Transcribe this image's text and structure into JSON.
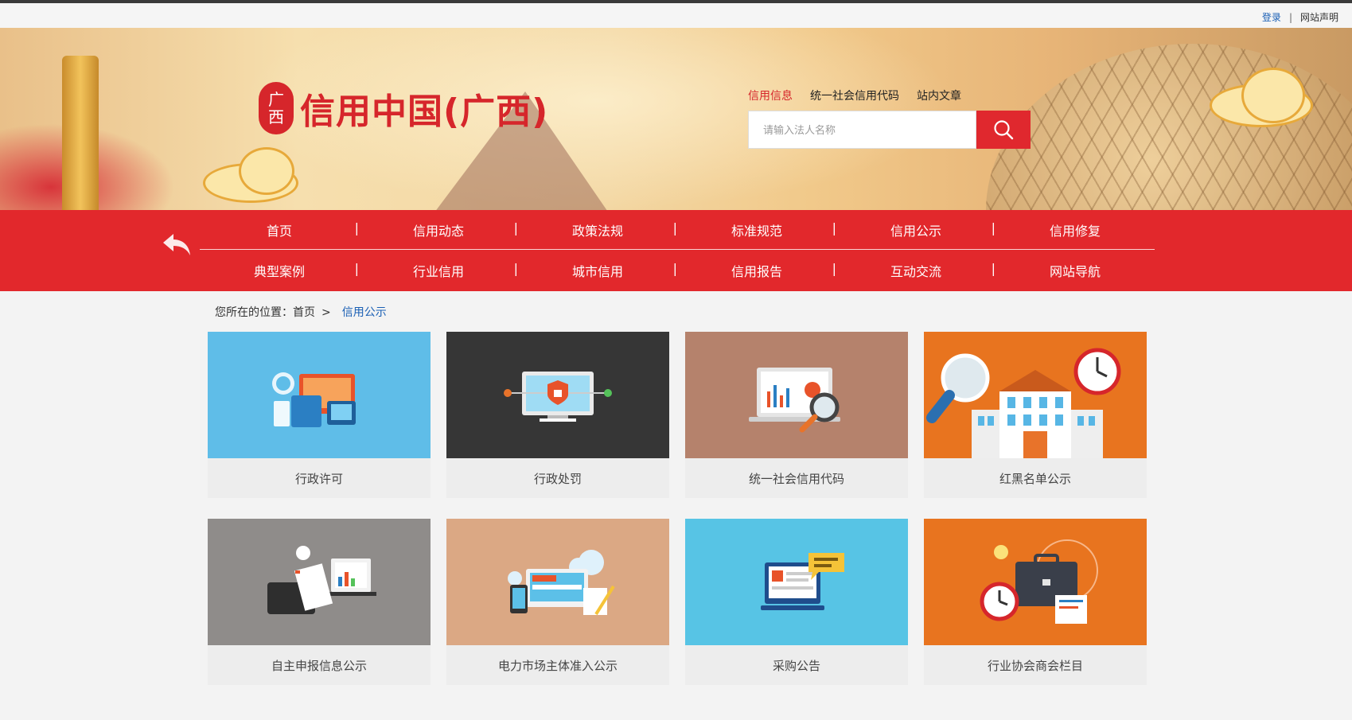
{
  "topbar": {
    "login": "登录",
    "separator": "|",
    "notice": "网站声明"
  },
  "brand": {
    "seal_top": "广",
    "seal_bottom": "西",
    "title": "信用中国(广西)"
  },
  "search": {
    "tabs": [
      "信用信息",
      "统一社会信用代码",
      "站内文章"
    ],
    "active_tab": "信用信息",
    "placeholder": "请输入法人名称",
    "button_icon": "search-icon"
  },
  "nav": {
    "row1": [
      "首页",
      "信用动态",
      "政策法规",
      "标准规范",
      "信用公示",
      "信用修复"
    ],
    "row2": [
      "典型案例",
      "行业信用",
      "城市信用",
      "信用报告",
      "互动交流",
      "网站导航"
    ],
    "back_icon": "back-arrow-icon"
  },
  "breadcrumb": {
    "prefix": "您所在的位置：",
    "home": "首页",
    "arrow": ">",
    "current": "信用公示"
  },
  "cards": [
    {
      "label": "行政许可",
      "icon": "devices-globe-icon",
      "color": "#5fbde8"
    },
    {
      "label": "行政处罚",
      "icon": "monitor-lock-icon",
      "color": "#363636"
    },
    {
      "label": "统一社会信用代码",
      "icon": "laptop-magnifier-icon",
      "color": "#b5826c"
    },
    {
      "label": "红黑名单公示",
      "icon": "building-clock-icon",
      "color": "#e8741f"
    },
    {
      "label": "自主申报信息公示",
      "icon": "briefcase-documents-icon",
      "color": "#8f8c8a"
    },
    {
      "label": "电力市场主体准入公示",
      "icon": "cloud-devices-icon",
      "color": "#dba884"
    },
    {
      "label": "采购公告",
      "icon": "computer-chat-icon",
      "color": "#57c4e5"
    },
    {
      "label": "行业协会商会栏目",
      "icon": "briefcase-clock-icon",
      "color": "#e8741f"
    }
  ]
}
